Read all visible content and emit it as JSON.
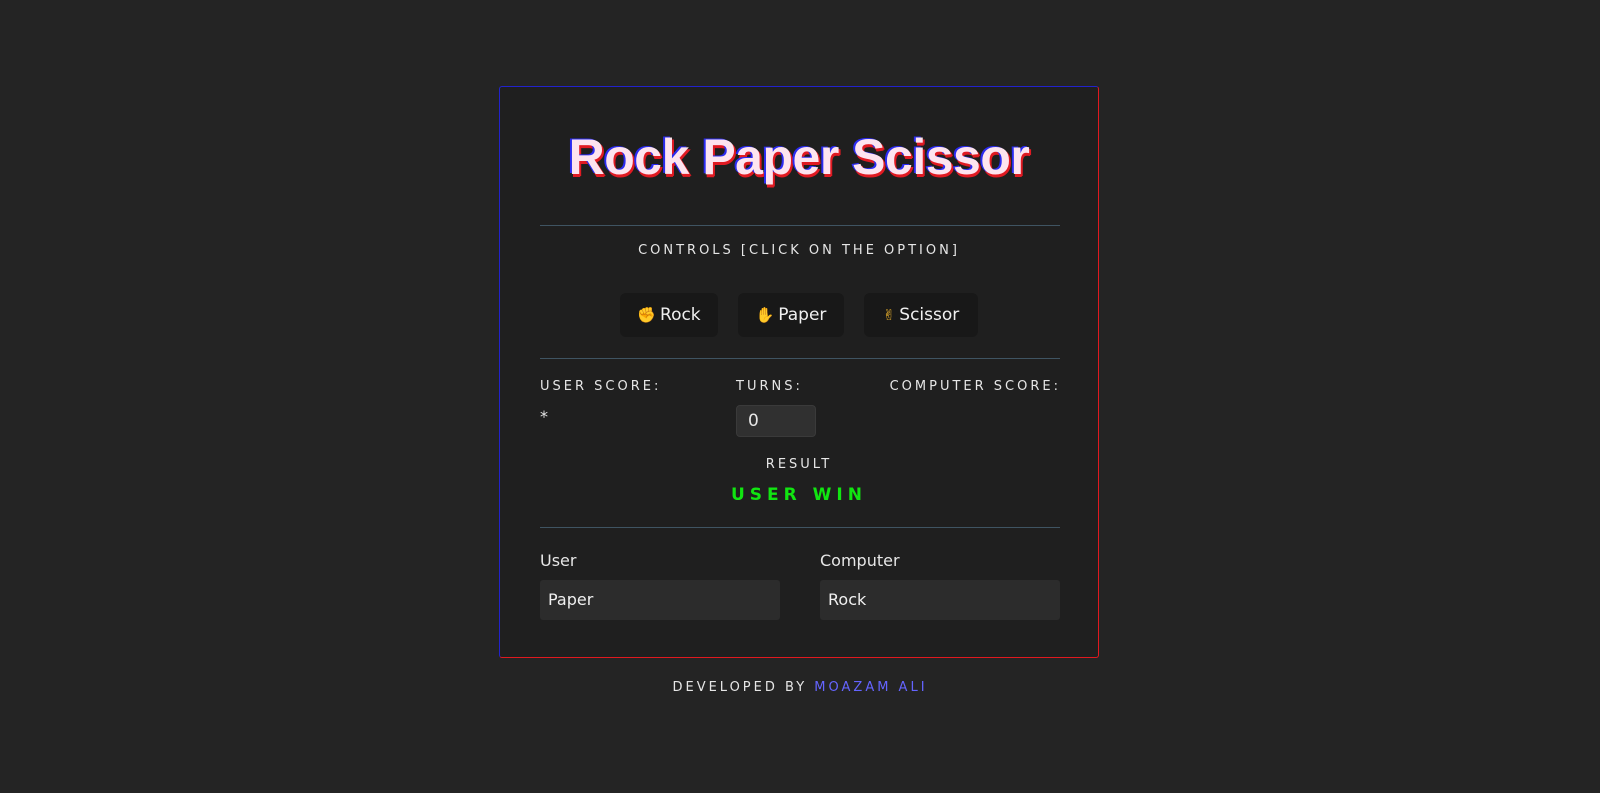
{
  "title": "Rock Paper Scissor",
  "controls_label": "CONTROLS [CLICK ON THE OPTION]",
  "options": [
    {
      "emoji": "✊",
      "label": "Rock"
    },
    {
      "emoji": "✋",
      "label": "Paper"
    },
    {
      "emoji": "✌",
      "label": "Scissor"
    }
  ],
  "scoreboard": {
    "user_score_label": "USER SCORE:",
    "user_score_value": "*",
    "turns_label": "TURNS:",
    "turns_value": "0",
    "computer_score_label": "COMPUTER SCORE:",
    "computer_score_value": ""
  },
  "result": {
    "label": "RESULT",
    "value": "USER WIN",
    "color": "#11e511"
  },
  "choices": {
    "user_label": "User",
    "user_value": "Paper",
    "computer_label": "Computer",
    "computer_value": "Rock"
  },
  "footer": {
    "prefix": "DEVELOPED BY",
    "author": "MOAZAM ALI",
    "author_color": "#6464ff"
  },
  "colors": {
    "background": "#242424",
    "card": "#1f1f1f",
    "border_blue": "#2222cc",
    "border_red": "#e0191f",
    "emoji": "#f3b72d"
  }
}
